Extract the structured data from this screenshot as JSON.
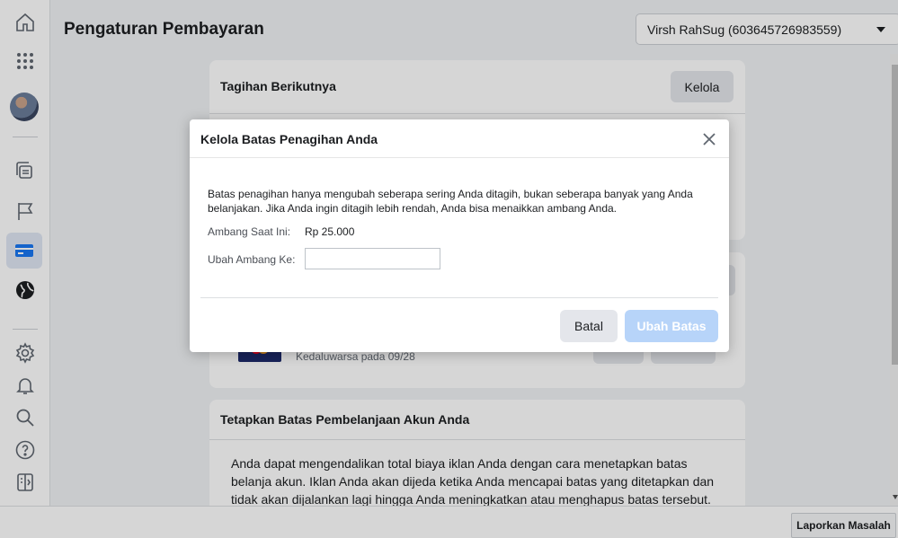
{
  "page": {
    "title": "Pengaturan Pembayaran",
    "account_select": "Virsh RahSug (603645726983559)"
  },
  "rail": {
    "icons": [
      "home-icon",
      "apps-grid-icon",
      "avatar",
      "pages-icon",
      "flag-icon",
      "credit-card-icon",
      "globe-icon",
      "settings-icon",
      "bell-icon",
      "search-icon",
      "help-icon",
      "report-panel-icon"
    ]
  },
  "cards": {
    "next_bill": {
      "title": "Tagihan Berikutnya",
      "manage_button": "Kelola"
    },
    "payment_method": {
      "expiry": "Kedaluwarsa pada 09/28"
    },
    "spending_limit": {
      "title": "Tetapkan Batas Pembelanjaan Akun Anda",
      "body": "Anda dapat mengendalikan total biaya iklan Anda dengan cara menetapkan batas belanja akun. Iklan Anda akan dijeda ketika Anda mencapai batas yang ditetapkan dan tidak akan dijalankan lagi hingga Anda meningkatkan atau menghapus batas tersebut."
    }
  },
  "modal": {
    "title": "Kelola Batas Penagihan Anda",
    "description": "Batas penagihan hanya mengubah seberapa sering Anda ditagih, bukan seberapa banyak yang Anda belanjakan. Jika Anda ingin ditagih lebih rendah, Anda bisa menaikkan ambang Anda.",
    "current_label": "Ambang Saat Ini:",
    "current_value": "Rp 25.000",
    "change_label": "Ubah Ambang Ke:",
    "change_value": "",
    "cancel_button": "Batal",
    "submit_button": "Ubah Batas"
  },
  "footer": {
    "report_button": "Laporkan Masalah"
  },
  "colors": {
    "accent": "#1877f2",
    "submit_disabled": "#b7d4f9"
  }
}
